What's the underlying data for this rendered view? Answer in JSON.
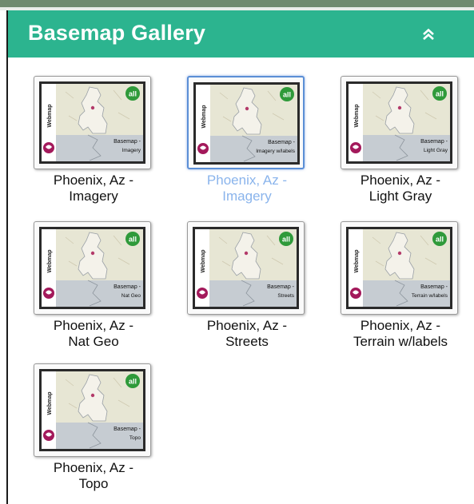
{
  "panel": {
    "title": "Basemap Gallery",
    "collapse_icon": "double-chevron-up-icon",
    "colors": {
      "header": "#2cb48f",
      "selected_label": "#8ab4ec",
      "selected_border": "#5b8fd6"
    }
  },
  "thumbnail_text": {
    "side_label": "Webmap",
    "badge": "all",
    "prefix": "Basemap -"
  },
  "basemaps": [
    {
      "line1": "Phoenix, Az -",
      "line2": "Imagery",
      "caption": "Imagery",
      "selected": false
    },
    {
      "line1": "Phoenix, Az -",
      "line2": "Imagery",
      "caption": "Imagery w/labels",
      "selected": true
    },
    {
      "line1": "Phoenix, Az -",
      "line2": "Light Gray",
      "caption": "Light Gray",
      "selected": false
    },
    {
      "line1": "Phoenix, Az -",
      "line2": "Nat Geo",
      "caption": "Nat Geo",
      "selected": false
    },
    {
      "line1": "Phoenix, Az -",
      "line2": "Streets",
      "caption": "Streets",
      "selected": false
    },
    {
      "line1": "Phoenix, Az -",
      "line2": "Terrain w/labels",
      "caption": "Terrain w/labels",
      "selected": false
    },
    {
      "line1": "Phoenix, Az -",
      "line2": "Topo",
      "caption": "Topo",
      "selected": false
    }
  ]
}
